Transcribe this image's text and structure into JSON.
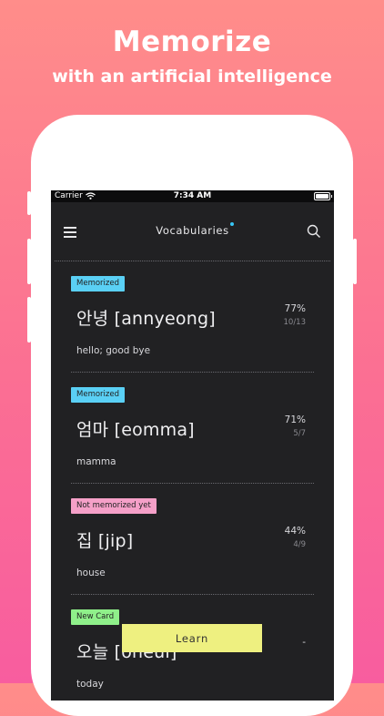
{
  "promo": {
    "headline": "Memorize",
    "subline": "with an artificial intelligence"
  },
  "status_bar": {
    "carrier": "Carrier",
    "time": "7:34 AM"
  },
  "nav": {
    "title": "Vocabularies"
  },
  "cards": [
    {
      "status": "Memorized",
      "status_color": "#5ad0f5",
      "word": "안녕 [annyeong]",
      "meaning": "hello; good bye",
      "percent": "77%",
      "ratio": "10/13"
    },
    {
      "status": "Memorized",
      "status_color": "#5ad0f5",
      "word": "엄마 [eomma]",
      "meaning": "mamma",
      "percent": "71%",
      "ratio": "5/7"
    },
    {
      "status": "Not memorized yet",
      "status_color": "#f5a0c8",
      "word": "집 [jip]",
      "meaning": "house",
      "percent": "44%",
      "ratio": "4/9"
    },
    {
      "status": "New Card",
      "status_color": "#8ff08a",
      "word": "오늘 [oneul]",
      "meaning": "today",
      "percent": "-",
      "ratio": ""
    }
  ],
  "learn_button": "Learn",
  "colors": {
    "screen_bg": "#212123",
    "accent_dot": "#37c6f5",
    "learn_button": "#eef080"
  }
}
